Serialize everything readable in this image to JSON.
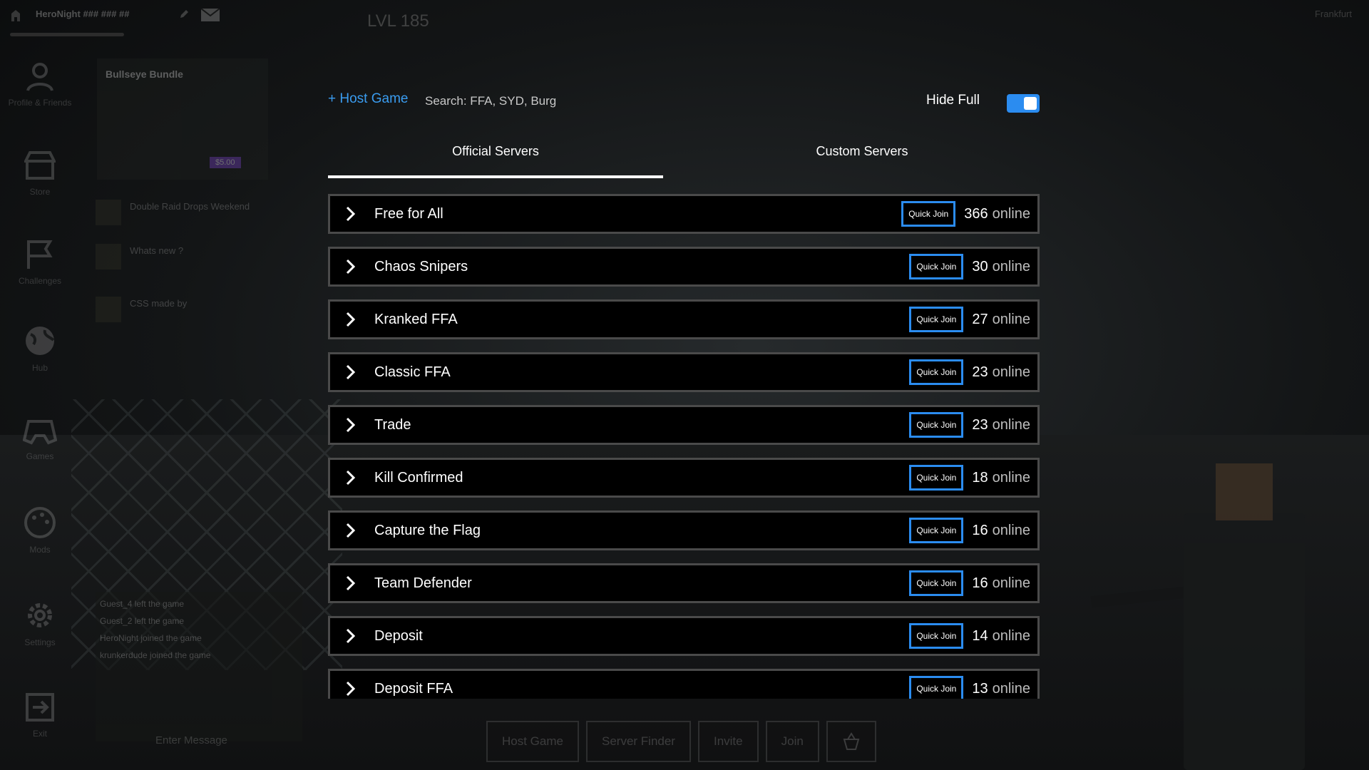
{
  "topbar": {
    "username": "HeroNight ### ### ##",
    "level": "LVL 185",
    "region": "Frankfurt"
  },
  "sidebar": {
    "items": [
      {
        "label": "Profile & Friends",
        "icon": "profile-icon"
      },
      {
        "label": "Store",
        "icon": "store-icon"
      },
      {
        "label": "Challenges",
        "icon": "flag-icon"
      },
      {
        "label": "Hub",
        "icon": "globe-icon"
      },
      {
        "label": "Games",
        "icon": "gamepad-icon"
      },
      {
        "label": "Mods",
        "icon": "palette-icon"
      },
      {
        "label": "Settings",
        "icon": "gear-icon"
      },
      {
        "label": "Exit",
        "icon": "exit-icon"
      }
    ]
  },
  "news": {
    "featured_title": "Bullseye Bundle",
    "featured_price": "$5.00",
    "items": [
      {
        "text": "Double Raid Drops Weekend"
      },
      {
        "text": "Whats new ?"
      },
      {
        "text": "CSS made by"
      }
    ]
  },
  "chat": {
    "messages": [
      "Guest_4 left the game",
      "Guest_2 left the game",
      "HeroNight joined the game",
      "krunkerdude joined the game"
    ],
    "placeholder": "Enter Message"
  },
  "browser": {
    "host_label": "+ Host Game",
    "search_placeholder": "Search: FFA, SYD, Burg",
    "hide_full_label": "Hide Full",
    "hide_full_on": true,
    "tabs": {
      "official": "Official Servers",
      "custom": "Custom Servers"
    },
    "active_tab": "official",
    "quick_join_label": "Quick Join",
    "online_label": "online",
    "modes": [
      {
        "name": "Free for All",
        "count": "366"
      },
      {
        "name": "Chaos Snipers",
        "count": "30"
      },
      {
        "name": "Kranked FFA",
        "count": "27"
      },
      {
        "name": "Classic FFA",
        "count": "23"
      },
      {
        "name": "Trade",
        "count": "23"
      },
      {
        "name": "Kill Confirmed",
        "count": "18"
      },
      {
        "name": "Capture the Flag",
        "count": "16"
      },
      {
        "name": "Team Defender",
        "count": "16"
      },
      {
        "name": "Deposit",
        "count": "14"
      },
      {
        "name": "Deposit FFA",
        "count": "13"
      }
    ]
  },
  "bottom_buttons": [
    "Host Game",
    "Server Finder",
    "Invite",
    "Join"
  ],
  "colors": {
    "accent": "#2b8cf0",
    "row_border": "#4a4a4a",
    "background": "#0b0c0d"
  }
}
